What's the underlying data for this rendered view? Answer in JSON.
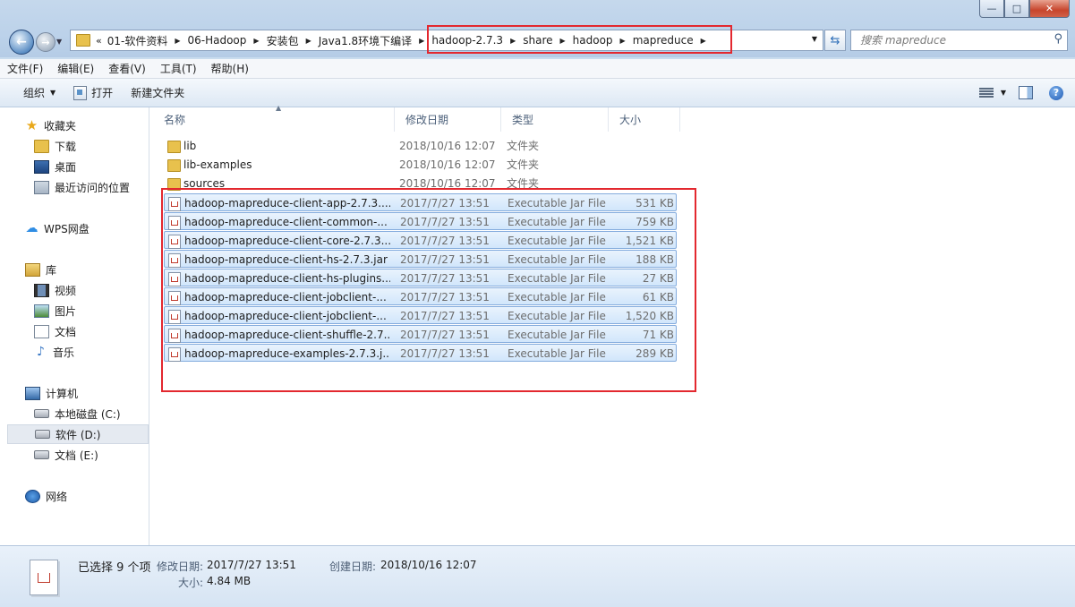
{
  "window": {
    "minimize_glyph": "—",
    "maximize_glyph": "□",
    "close_glyph": "✕"
  },
  "nav": {
    "back_glyph": "←",
    "forward_glyph": "→"
  },
  "address": {
    "lead": "«",
    "crumbs": [
      "01-软件资料",
      "06-Hadoop",
      "安装包",
      "Java1.8环境下编译",
      "hadoop-2.7.3",
      "share",
      "hadoop",
      "mapreduce"
    ]
  },
  "search": {
    "placeholder": "搜索 mapreduce"
  },
  "menu": {
    "items": [
      "文件(F)",
      "编辑(E)",
      "查看(V)",
      "工具(T)",
      "帮助(H)"
    ]
  },
  "toolbar": {
    "organize": "组织",
    "open": "打开",
    "new_folder": "新建文件夹",
    "help_glyph": "?"
  },
  "sidebar": {
    "favorites": "收藏夹",
    "downloads": "下载",
    "desktop": "桌面",
    "recent": "最近访问的位置",
    "wps": "WPS网盘",
    "libraries": "库",
    "videos": "视频",
    "pictures": "图片",
    "documents": "文档",
    "music": "音乐",
    "computer": "计算机",
    "disk_c": "本地磁盘 (C:)",
    "disk_d": "软件 (D:)",
    "disk_e": "文档 (E:)",
    "network": "网络"
  },
  "columns": {
    "name": "名称",
    "date": "修改日期",
    "type": "类型",
    "size": "大小"
  },
  "files": [
    {
      "name": "lib",
      "date": "2018/10/16 12:07",
      "type": "文件夹",
      "size": "",
      "kind": "folder",
      "selected": false
    },
    {
      "name": "lib-examples",
      "date": "2018/10/16 12:07",
      "type": "文件夹",
      "size": "",
      "kind": "folder",
      "selected": false
    },
    {
      "name": "sources",
      "date": "2018/10/16 12:07",
      "type": "文件夹",
      "size": "",
      "kind": "folder",
      "selected": false
    },
    {
      "name": "hadoop-mapreduce-client-app-2.7.3....",
      "date": "2017/7/27 13:51",
      "type": "Executable Jar File",
      "size": "531 KB",
      "kind": "jar",
      "selected": true
    },
    {
      "name": "hadoop-mapreduce-client-common-...",
      "date": "2017/7/27 13:51",
      "type": "Executable Jar File",
      "size": "759 KB",
      "kind": "jar",
      "selected": true
    },
    {
      "name": "hadoop-mapreduce-client-core-2.7.3...",
      "date": "2017/7/27 13:51",
      "type": "Executable Jar File",
      "size": "1,521 KB",
      "kind": "jar",
      "selected": true
    },
    {
      "name": "hadoop-mapreduce-client-hs-2.7.3.jar",
      "date": "2017/7/27 13:51",
      "type": "Executable Jar File",
      "size": "188 KB",
      "kind": "jar",
      "selected": true
    },
    {
      "name": "hadoop-mapreduce-client-hs-plugins...",
      "date": "2017/7/27 13:51",
      "type": "Executable Jar File",
      "size": "27 KB",
      "kind": "jar",
      "selected": true
    },
    {
      "name": "hadoop-mapreduce-client-jobclient-...",
      "date": "2017/7/27 13:51",
      "type": "Executable Jar File",
      "size": "61 KB",
      "kind": "jar",
      "selected": true
    },
    {
      "name": "hadoop-mapreduce-client-jobclient-...",
      "date": "2017/7/27 13:51",
      "type": "Executable Jar File",
      "size": "1,520 KB",
      "kind": "jar",
      "selected": true
    },
    {
      "name": "hadoop-mapreduce-client-shuffle-2.7...",
      "date": "2017/7/27 13:51",
      "type": "Executable Jar File",
      "size": "71 KB",
      "kind": "jar",
      "selected": true
    },
    {
      "name": "hadoop-mapreduce-examples-2.7.3.j...",
      "date": "2017/7/27 13:51",
      "type": "Executable Jar File",
      "size": "289 KB",
      "kind": "jar",
      "selected": true
    }
  ],
  "details": {
    "selected": "已选择 9 个项",
    "modified_label": "修改日期:",
    "modified_value": "2017/7/27 13:51",
    "created_label": "创建日期:",
    "created_value": "2018/10/16 12:07",
    "size_label": "大小:",
    "size_value": "4.84 MB"
  },
  "colors": {
    "highlight_box": "#e3282f",
    "selection_border": "#84acdd"
  }
}
